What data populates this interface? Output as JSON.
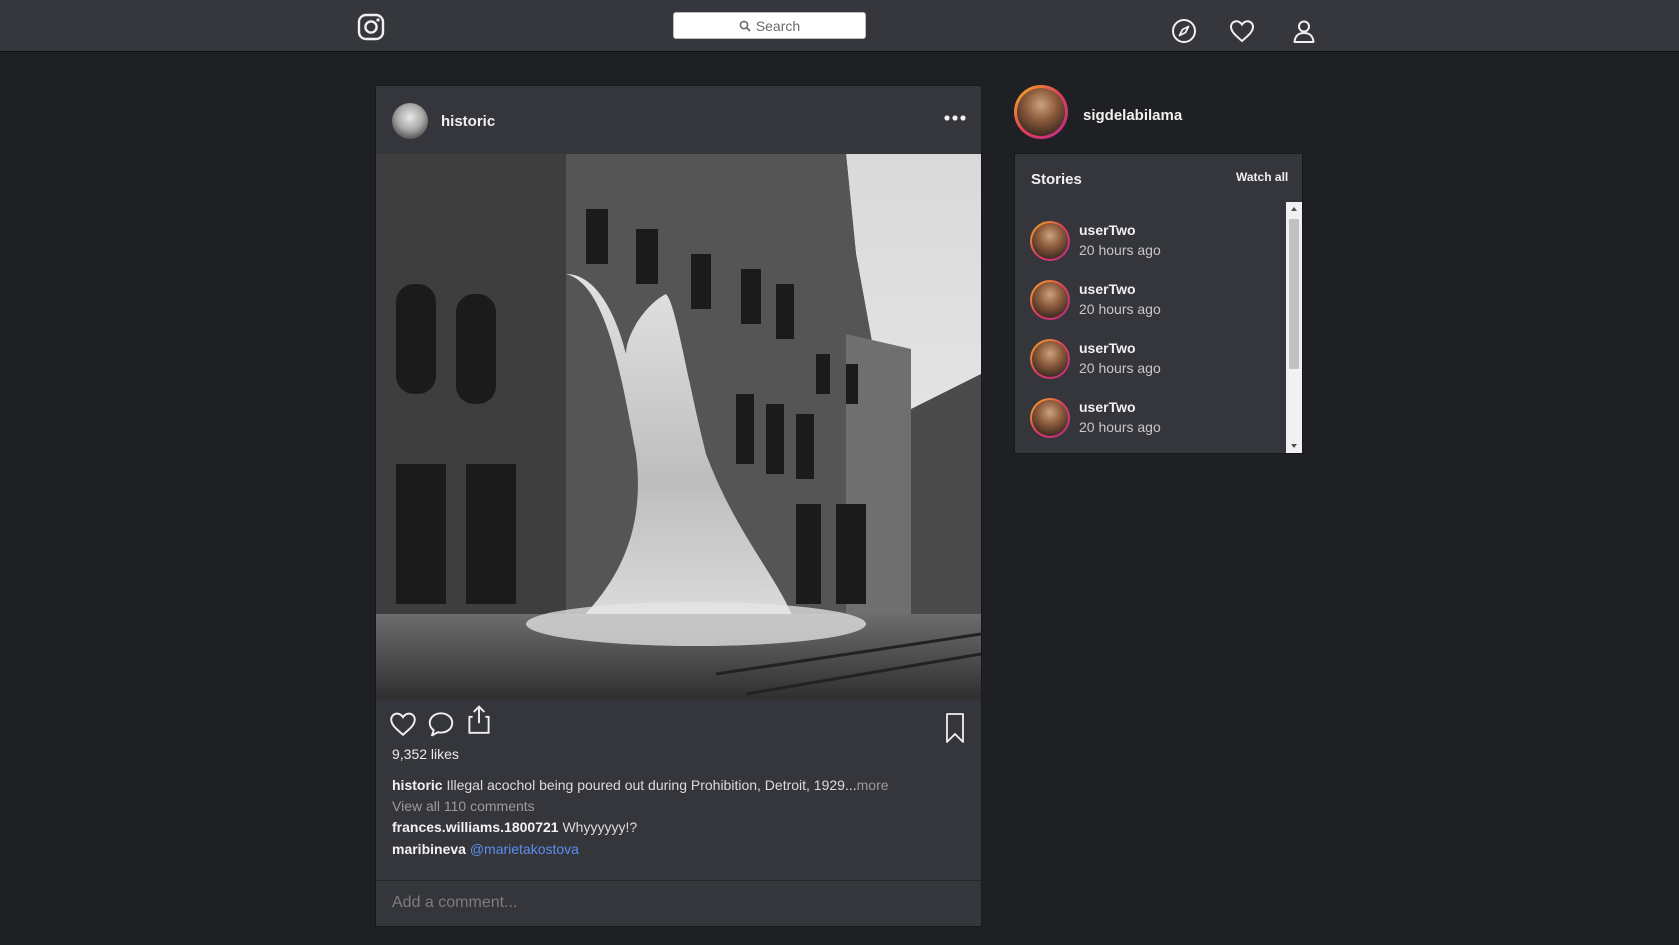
{
  "header": {
    "logo_icon": "instagram-icon",
    "search_placeholder": "Search",
    "icons": [
      "compass-icon",
      "heart-icon",
      "user-icon"
    ]
  },
  "post": {
    "username": "historic",
    "image_alt": "Illegal acochol being poured out during Prohibition, Detroit, 1929",
    "likes": "9,352 likes",
    "caption": {
      "user": "historic",
      "text": "Illegal acochol being poured out during Prohibition, Detroit, 1929...",
      "more": "more"
    },
    "view_all_comments": "View all 110 comments",
    "comments": [
      {
        "user": "frances.williams.1800721",
        "text": "Whyyyyyy!?"
      },
      {
        "user": "maribineva",
        "text": "@marietakostova"
      }
    ],
    "add_comment_placeholder": "Add a comment..."
  },
  "sidebar": {
    "current_user": "sigdelabilama",
    "stories_title": "Stories",
    "watch_all": "Watch all",
    "stories": [
      {
        "user": "userTwo",
        "time": "20 hours ago"
      },
      {
        "user": "userTwo",
        "time": "20 hours ago"
      },
      {
        "user": "userTwo",
        "time": "20 hours ago"
      },
      {
        "user": "userTwo",
        "time": "20 hours ago"
      }
    ]
  },
  "colors": {
    "topbar": "#35373c",
    "background": "#1f2023",
    "card": "#34363b",
    "mention": "#5b8ef0",
    "story_ring": "#e03e5a"
  }
}
